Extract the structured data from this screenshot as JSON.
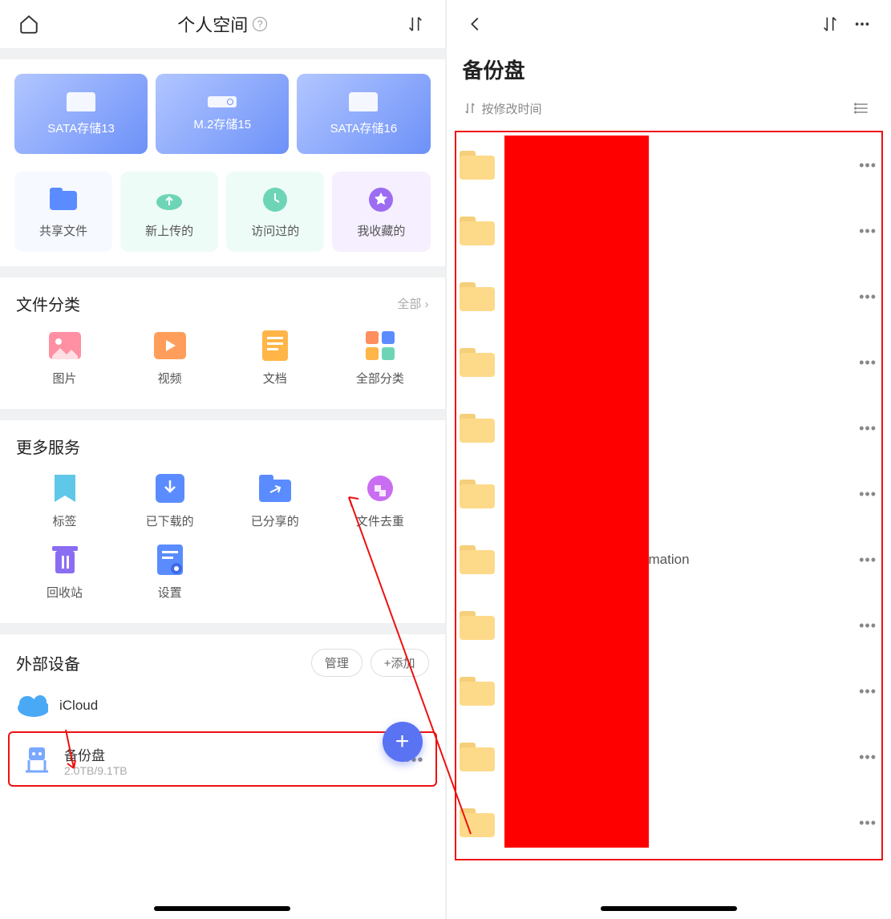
{
  "left": {
    "title": "个人空间",
    "storage": [
      {
        "label": "SATA存储13"
      },
      {
        "label": "M.2存储15"
      },
      {
        "label": "SATA存储16"
      }
    ],
    "quick": [
      {
        "label": "共享文件"
      },
      {
        "label": "新上传的"
      },
      {
        "label": "访问过的"
      },
      {
        "label": "我收藏的"
      }
    ],
    "categories": {
      "title": "文件分类",
      "more": "全部 ›",
      "items": [
        {
          "label": "图片"
        },
        {
          "label": "视频"
        },
        {
          "label": "文档"
        },
        {
          "label": "全部分类"
        }
      ]
    },
    "services": {
      "title": "更多服务",
      "items": [
        {
          "label": "标签"
        },
        {
          "label": "已下载的"
        },
        {
          "label": "已分享的"
        },
        {
          "label": "文件去重"
        },
        {
          "label": "回收站"
        },
        {
          "label": "设置"
        }
      ]
    },
    "external": {
      "title": "外部设备",
      "manage": "管理",
      "add": "+添加",
      "cloud": {
        "label": "iCloud"
      },
      "backup": {
        "label": "备份盘",
        "sub": "2.0TB/9.1TB"
      }
    }
  },
  "right": {
    "title": "备份盘",
    "sort": "按修改时间",
    "rows": 11,
    "visible_text_row7": "mation"
  }
}
